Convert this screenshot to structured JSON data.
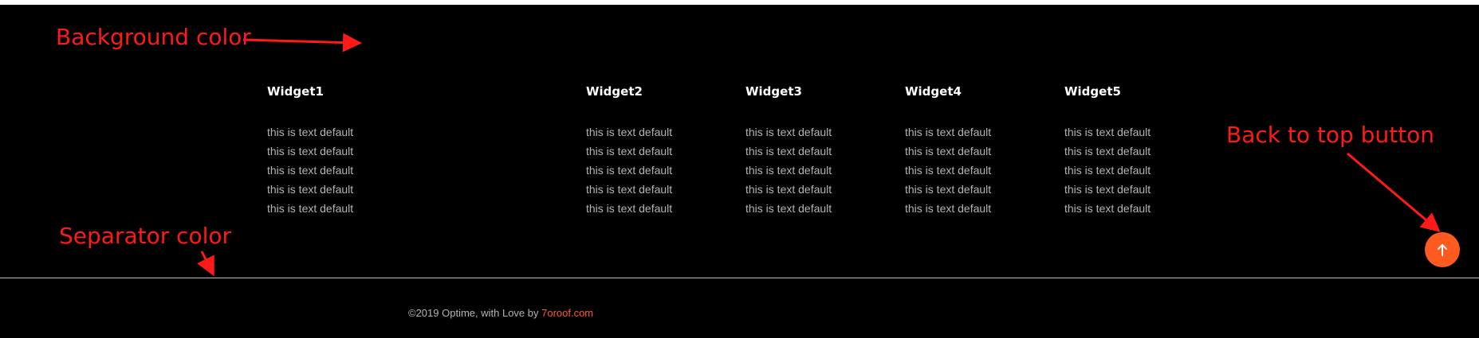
{
  "annotations": {
    "background_color": "Background color",
    "separator_color": "Separator color",
    "back_to_top_button": "Back to top button"
  },
  "widgets": [
    {
      "title": "Widget1",
      "items": [
        "this is text default",
        "this is text default",
        "this is text default",
        "this is text default",
        "this is text default"
      ]
    },
    {
      "title": "Widget2",
      "items": [
        "this is text default",
        "this is text default",
        "this is text default",
        "this is text default",
        "this is text default"
      ]
    },
    {
      "title": "Widget3",
      "items": [
        "this is text default",
        "this is text default",
        "this is text default",
        "this is text default",
        "this is text default"
      ]
    },
    {
      "title": "Widget4",
      "items": [
        "this is text default",
        "this is text default",
        "this is text default",
        "this is text default",
        "this is text default"
      ]
    },
    {
      "title": "Widget5",
      "items": [
        "this is text default",
        "this is text default",
        "this is text default",
        "this is text default",
        "this is text default"
      ]
    }
  ],
  "copyright": {
    "text": "©2019 Optime, with Love by ",
    "link": "7oroof.com"
  },
  "back_to_top_icon": "arrow-up-icon",
  "colors": {
    "background": "#000000",
    "separator": "#bdbdbd",
    "accent": "#ff5a1f",
    "annotation": "#ff1a1a",
    "text": "#b4b4b4",
    "heading": "#ffffff"
  }
}
